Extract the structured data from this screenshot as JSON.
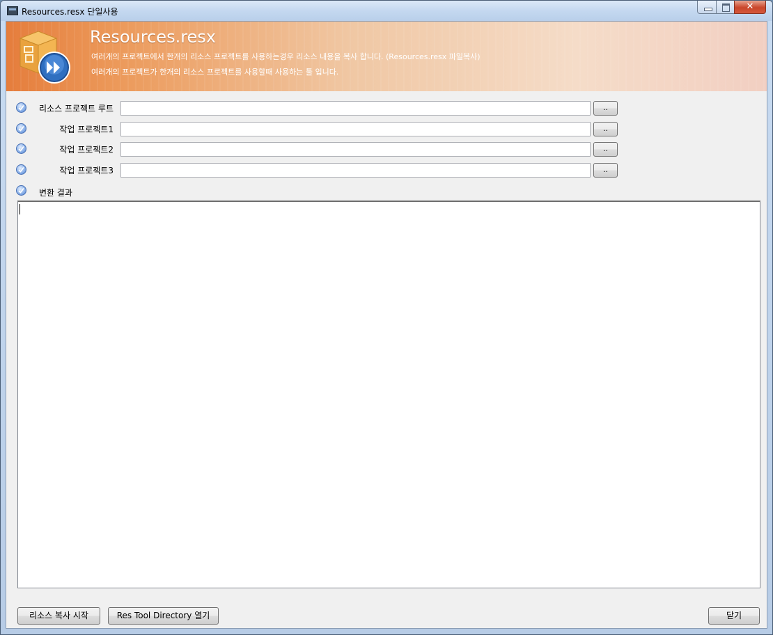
{
  "window": {
    "title": "Resources.resx  단일사용",
    "icons": {
      "app": "app-icon",
      "minimize": "minimize-icon",
      "maximize": "maximize-icon",
      "close": "close-icon"
    }
  },
  "banner": {
    "title": "Resources.resx",
    "line1": "여러개의 프로젝트에서 한개의 리소스 프로젝트를 사용하는경우 리소스 내용을 복사 합니다. (Resources.resx 파일복사)",
    "line2": "여러개의 프로젝트가 한개의 리소스 프로젝트를 사용할때 사용하는 툴 입니다."
  },
  "form": {
    "rows": [
      {
        "label": "리소스 프로젝트 루트",
        "value": "",
        "browse": ".."
      },
      {
        "label": "작업 프로젝트1",
        "value": "",
        "browse": ".."
      },
      {
        "label": "작업 프로젝트2",
        "value": "",
        "browse": ".."
      },
      {
        "label": "작업 프로젝트3",
        "value": "",
        "browse": ".."
      }
    ],
    "result_label": "변환 결과",
    "result_text": ""
  },
  "buttons": {
    "start_copy": "리소스 복사 시작",
    "open_dir": "Res Tool Directory 열기",
    "close": "닫기"
  }
}
